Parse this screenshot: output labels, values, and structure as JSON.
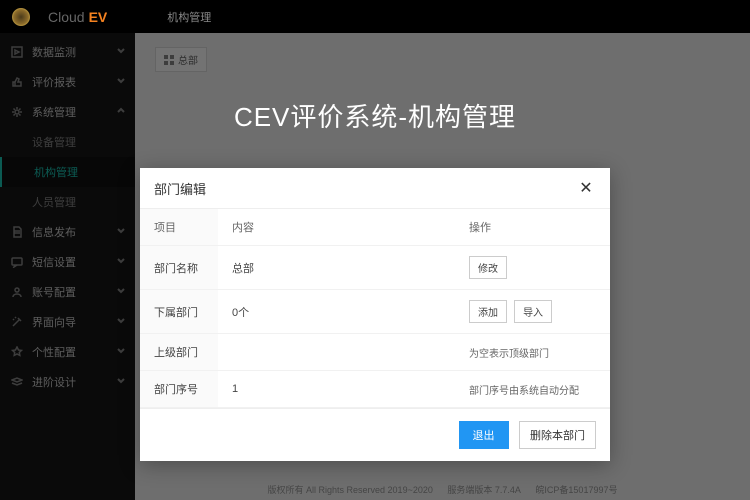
{
  "topbar": {
    "brand_cloud": "Cloud",
    "brand_ev": "EV",
    "page_title": "机构管理"
  },
  "sidebar": {
    "items": [
      {
        "label": "数据监测",
        "type": "group",
        "expandable": true
      },
      {
        "label": "评价报表",
        "type": "group",
        "expandable": true
      },
      {
        "label": "系统管理",
        "type": "group",
        "expandable": true,
        "expanded": true
      },
      {
        "label": "设备管理",
        "type": "sub"
      },
      {
        "label": "机构管理",
        "type": "sub",
        "active": true
      },
      {
        "label": "人员管理",
        "type": "sub"
      },
      {
        "label": "信息发布",
        "type": "group",
        "expandable": true
      },
      {
        "label": "短信设置",
        "type": "group",
        "expandable": true
      },
      {
        "label": "账号配置",
        "type": "group",
        "expandable": true
      },
      {
        "label": "界面向导",
        "type": "group",
        "expandable": true
      },
      {
        "label": "个性配置",
        "type": "group",
        "expandable": true
      },
      {
        "label": "进阶设计",
        "type": "group",
        "expandable": true
      }
    ]
  },
  "breadcrumb": {
    "label": "总部"
  },
  "banner": "CEV评价系统-机构管理",
  "modal": {
    "title": "部门编辑",
    "headers": {
      "c1": "项目",
      "c2": "内容",
      "c3": "操作"
    },
    "rows": {
      "name": {
        "label": "部门名称",
        "value": "总部",
        "action": "修改"
      },
      "child": {
        "label": "下属部门",
        "value": "0个",
        "action1": "添加",
        "action2": "导入"
      },
      "parent": {
        "label": "上级部门",
        "value": "",
        "note": "为空表示顶级部门"
      },
      "seq": {
        "label": "部门序号",
        "value": "1",
        "note": "部门序号由系统自动分配"
      }
    },
    "footer": {
      "exit": "退出",
      "delete": "删除本部门"
    }
  },
  "footer": {
    "copyright": "版权所有 All Rights Reserved 2019~2020",
    "version": "服务端版本 7.7.4A",
    "icp": "皖ICP备15017997号"
  }
}
